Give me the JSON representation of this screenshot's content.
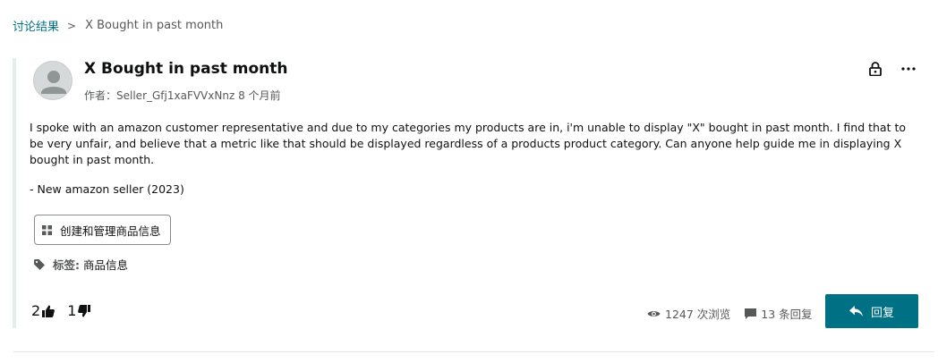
{
  "breadcrumb": {
    "root": "讨论结果",
    "separator": ">",
    "current": "X Bought in past month"
  },
  "post": {
    "title": "X Bought in past month",
    "author_label": "作者：",
    "author_name": "Seller_Gfj1xaFVVxNnz",
    "posted_ago": "8 个月前",
    "body": "I spoke with an amazon customer representative and due to my categories my products are in, i'm unable to display \"X\" bought in past month. I find that to be very unfair, and believe that a metric like that should be displayed regardless of a products product category. Can anyone help guide me in displaying X bought in past month.",
    "signature": "- New amazon seller (2023)",
    "category_button": "创建和管理商品信息",
    "tags_label": "标签:",
    "tag": "商品信息",
    "upvotes": "2",
    "downvotes": "1",
    "views": "1247 次浏览",
    "replies": "13 条回复",
    "reply_button": "回复"
  },
  "icons": {
    "lock": "lock-icon",
    "more": "more-icon",
    "thumbs_up": "thumbs-up-icon",
    "thumbs_down": "thumbs-down-icon",
    "eye": "eye-icon",
    "comment": "comment-icon",
    "reply": "reply-arrow-icon",
    "tag": "tag-icon",
    "grid": "grid-icon"
  },
  "colors": {
    "link": "#007185",
    "reply_button": "#007185",
    "muted_text": "#565959",
    "accent_bar": "#e3ede9"
  }
}
